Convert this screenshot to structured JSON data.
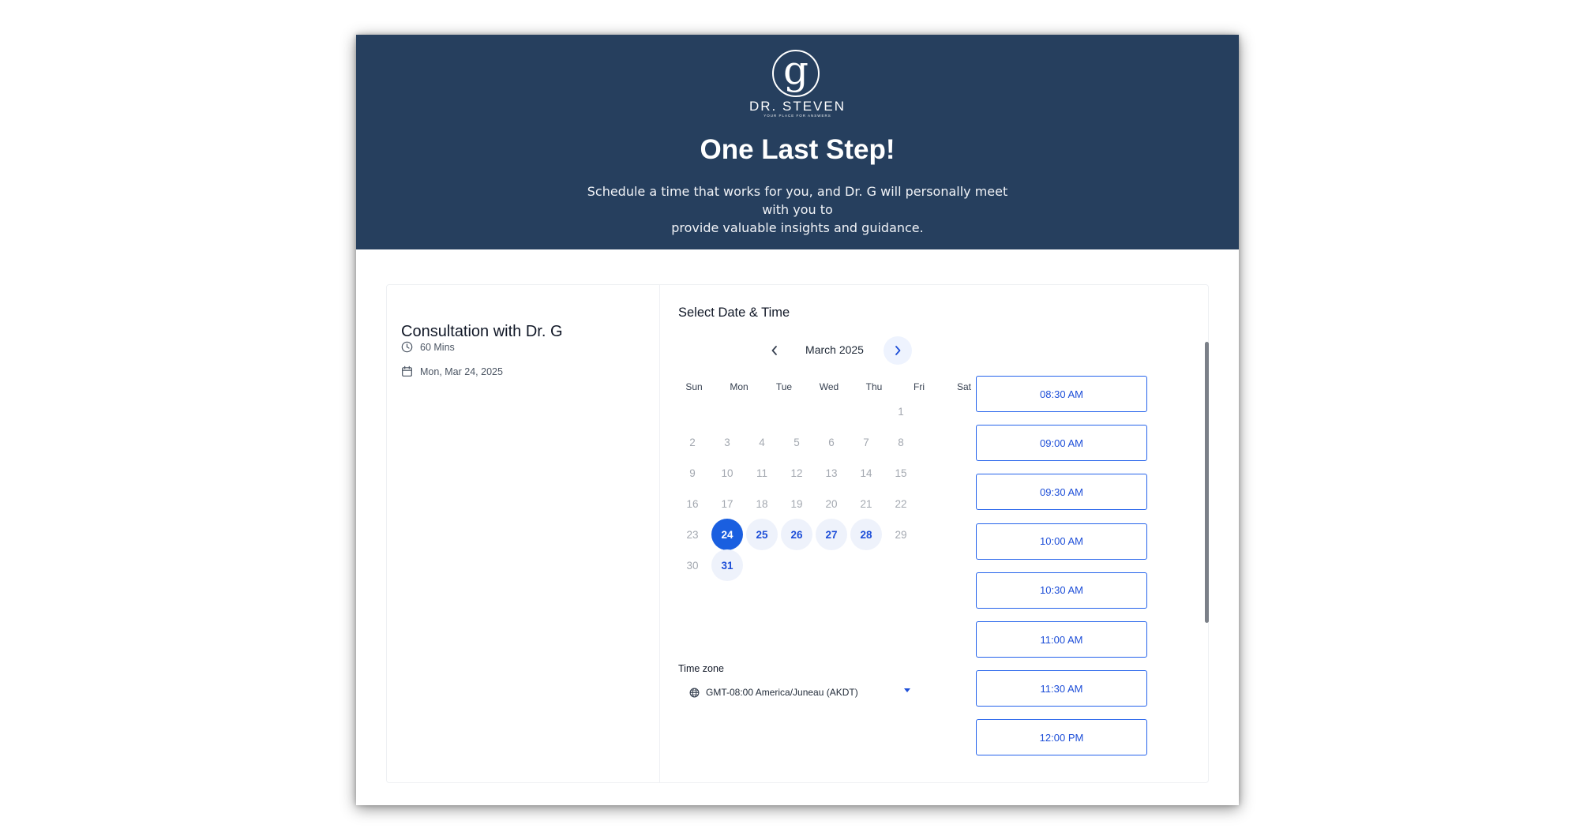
{
  "header": {
    "logo_letter": "g",
    "logo_name": "DR. STEVEN",
    "logo_tagline": "YOUR PLACE FOR ANSWERS",
    "title": "One Last Step!",
    "subtitle_line1": "Schedule a time that works for you, and Dr. G will personally meet with you to",
    "subtitle_line2": "provide valuable insights and guidance."
  },
  "event": {
    "title": "Consultation with Dr. G",
    "duration": "60 Mins",
    "date": "Mon, Mar 24, 2025"
  },
  "scheduler": {
    "section_title": "Select Date & Time",
    "month_label": "March 2025",
    "weekdays": [
      "Sun",
      "Mon",
      "Tue",
      "Wed",
      "Thu",
      "Fri",
      "Sat"
    ],
    "days": [
      {
        "label": "1",
        "state": "disabled"
      },
      {
        "label": "2",
        "state": "disabled"
      },
      {
        "label": "3",
        "state": "disabled"
      },
      {
        "label": "4",
        "state": "disabled"
      },
      {
        "label": "5",
        "state": "disabled"
      },
      {
        "label": "6",
        "state": "disabled"
      },
      {
        "label": "7",
        "state": "disabled"
      },
      {
        "label": "8",
        "state": "disabled"
      },
      {
        "label": "9",
        "state": "disabled"
      },
      {
        "label": "10",
        "state": "disabled"
      },
      {
        "label": "11",
        "state": "disabled"
      },
      {
        "label": "12",
        "state": "disabled"
      },
      {
        "label": "13",
        "state": "disabled"
      },
      {
        "label": "14",
        "state": "disabled"
      },
      {
        "label": "15",
        "state": "disabled"
      },
      {
        "label": "16",
        "state": "disabled"
      },
      {
        "label": "17",
        "state": "disabled"
      },
      {
        "label": "18",
        "state": "disabled"
      },
      {
        "label": "19",
        "state": "disabled"
      },
      {
        "label": "20",
        "state": "disabled"
      },
      {
        "label": "21",
        "state": "disabled"
      },
      {
        "label": "22",
        "state": "disabled"
      },
      {
        "label": "23",
        "state": "disabled"
      },
      {
        "label": "24",
        "state": "selected"
      },
      {
        "label": "25",
        "state": "available"
      },
      {
        "label": "26",
        "state": "available"
      },
      {
        "label": "27",
        "state": "available"
      },
      {
        "label": "28",
        "state": "available"
      },
      {
        "label": "29",
        "state": "disabled"
      },
      {
        "label": "30",
        "state": "disabled"
      },
      {
        "label": "31",
        "state": "available"
      }
    ],
    "timezone_label": "Time zone",
    "timezone_value": "GMT-08:00 America/Juneau (AKDT)",
    "time_slots": [
      "08:30 AM",
      "09:00 AM",
      "09:30 AM",
      "10:00 AM",
      "10:30 AM",
      "11:00 AM",
      "11:30 AM",
      "12:00 PM"
    ]
  },
  "colors": {
    "hero_bg": "#263f5e",
    "accent": "#1a5fe0",
    "available_bg": "#eef2fb"
  },
  "icons": [
    "clock-icon",
    "calendar-icon",
    "chevron-left-icon",
    "chevron-right-icon",
    "globe-icon",
    "caret-down-icon"
  ]
}
